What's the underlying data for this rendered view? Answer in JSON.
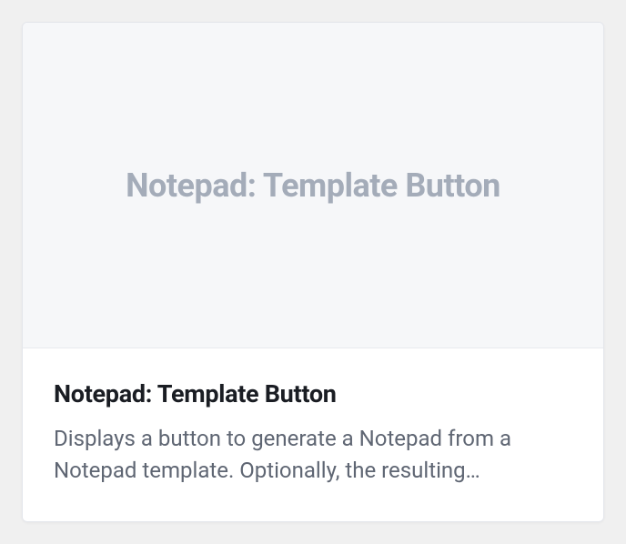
{
  "card": {
    "preview_label": "Notepad: Template Button",
    "title": "Notepad: Template Button",
    "description": "Displays a button to generate a Notepad from a Notepad template. Optionally, the resulting…"
  }
}
